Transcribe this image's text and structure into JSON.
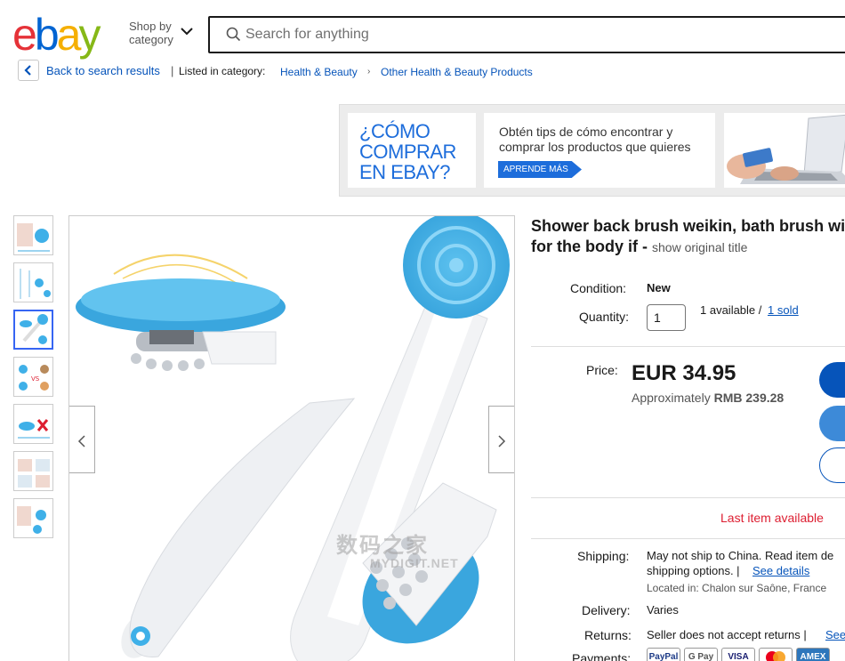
{
  "header": {
    "logo_letters": [
      "e",
      "b",
      "a",
      "y"
    ],
    "shop_by_label": "Shop by category",
    "search_placeholder": "Search for anything"
  },
  "breadcrumb": {
    "back_label": "Back to search results",
    "separator": "|",
    "listed_in": "Listed in category:",
    "categories": [
      "Health & Beauty",
      "Other Health & Beauty Products"
    ],
    "arrow": "›"
  },
  "banner": {
    "left_text": "¿CÓMO\nCOMPRAR\nEN EBAY?",
    "mid_text": "Obtén tips de cómo encontrar y\ncomprar los  productos que quieres",
    "cta_label": "APRENDE MÁS"
  },
  "gallery": {
    "thumbnail_count": 7,
    "active_index": 2
  },
  "watermark": {
    "text": "数码之家",
    "sub": "MYDIGIT.NET"
  },
  "item": {
    "title_line1": "Shower back brush weikin, bath brush wi",
    "title_line2": "for the body if -",
    "show_original": "show original title",
    "condition_label": "Condition:",
    "condition_value": "New",
    "quantity_label": "Quantity:",
    "quantity_value": "1",
    "available_text": "1 available /",
    "sold_text": "1 sold",
    "price_label": "Price:",
    "price": "EUR 34.95",
    "approx_label": "Approximately",
    "approx_value": "RMB 239.28",
    "last_item": "Last item available",
    "shipping_label": "Shipping:",
    "shipping_text_1": "May not ship to China. Read item de",
    "shipping_text_2": "shipping options. |",
    "see_details": "See details",
    "located_in": "Located in: Chalon sur Saône, France",
    "delivery_label": "Delivery:",
    "delivery_value": "Varies",
    "returns_label": "Returns:",
    "returns_value": "Seller does not accept returns |",
    "returns_link": "See",
    "payments_label": "Payments:",
    "payment_methods": [
      "PayPal",
      "G Pay",
      "VISA",
      "MC",
      "AMEX"
    ]
  },
  "colors": {
    "accent_blue": "#3665f3",
    "link_blue": "#0654ba",
    "alert_red": "#dd1e31",
    "brush_blue": "#3fb0e8"
  }
}
